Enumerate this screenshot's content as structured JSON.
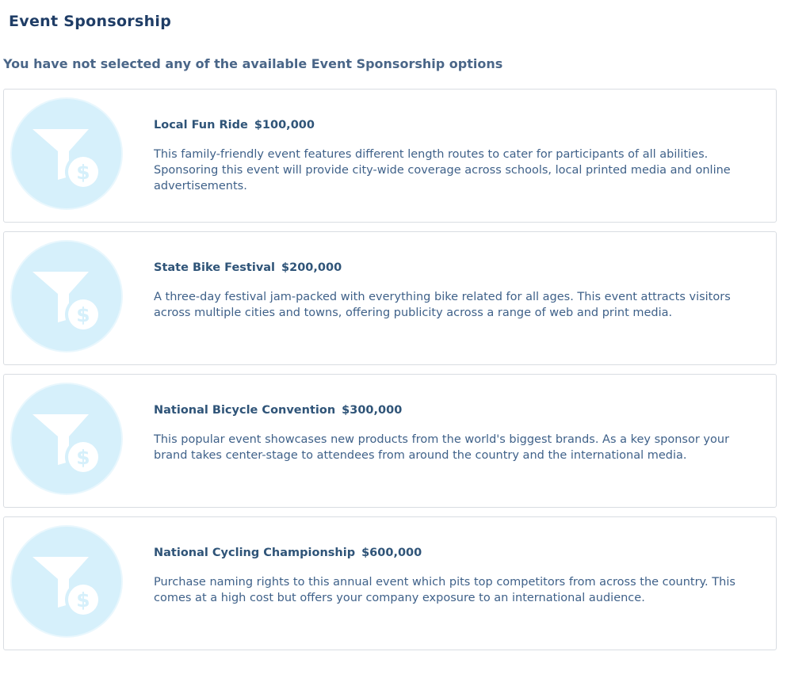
{
  "page": {
    "title": "Event Sponsorship",
    "status_message": "You have not selected any of the available Event Sponsorship options"
  },
  "colors": {
    "title": "#1f3d66",
    "status_text": "#4a6688",
    "heading": "#2f5478",
    "description": "#3f6189",
    "icon_bg": "#d6f0fb",
    "card_border": "#d9dde2"
  },
  "options": [
    {
      "icon": "funnel-dollar-icon",
      "name": "Local Fun Ride",
      "price": "$100,000",
      "description": "This family-friendly event features different length routes to cater for participants of all abilities. Sponsoring this event will provide city-wide coverage across schools, local printed media and online advertisements."
    },
    {
      "icon": "funnel-dollar-icon",
      "name": "State Bike Festival",
      "price": "$200,000",
      "description": "A three-day festival jam-packed with everything bike related for all ages. This event attracts visitors across multiple cities and towns, offering publicity across a range of web and print media."
    },
    {
      "icon": "funnel-dollar-icon",
      "name": "National Bicycle Convention",
      "price": "$300,000",
      "description": "This popular event showcases new products from the world's biggest brands. As a key sponsor your brand takes center-stage to attendees from around the country and the international media."
    },
    {
      "icon": "funnel-dollar-icon",
      "name": "National Cycling Championship",
      "price": "$600,000",
      "description": "Purchase naming rights to this annual event which pits top competitors from across the country. This comes at a high cost but offers your company exposure to an international audience."
    }
  ]
}
